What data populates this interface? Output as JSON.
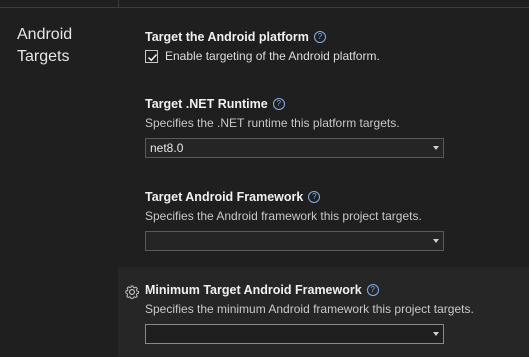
{
  "section": {
    "title": "Android\nTargets"
  },
  "settings": {
    "platform": {
      "title": "Target the Android platform",
      "checkbox_label": "Enable targeting of the Android platform.",
      "checked": true
    },
    "runtime": {
      "title": "Target .NET Runtime",
      "description": "Specifies the .NET runtime this platform targets.",
      "value": "net8.0"
    },
    "framework": {
      "title": "Target Android Framework",
      "description": "Specifies the Android framework this project targets.",
      "value": ""
    },
    "min_framework": {
      "title": "Minimum Target Android Framework",
      "description": "Specifies the minimum Android framework this project targets.",
      "value": ""
    }
  },
  "icons": {
    "help": "help-circle-icon",
    "settings": "gear-icon",
    "dropdown": "chevron-down-icon",
    "check": "checkmark-icon"
  },
  "colors": {
    "background": "#1f1f1f",
    "hover_panel": "#262626",
    "help_accent": "#7fb0e6"
  }
}
